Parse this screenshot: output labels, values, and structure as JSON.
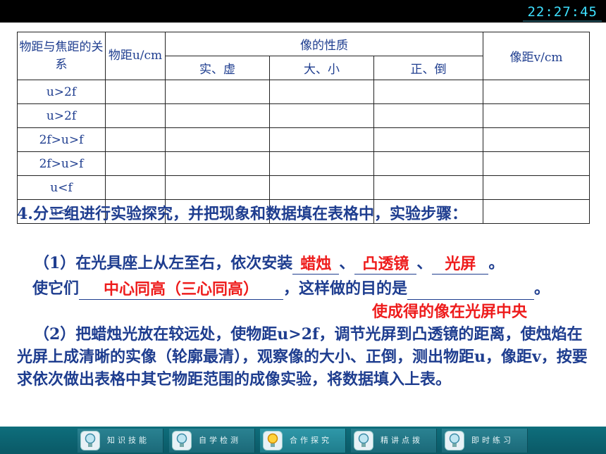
{
  "clock": "22:27:45",
  "table": {
    "headers": {
      "relation": "物距与焦距的关系",
      "object_distance": "物距u/cm",
      "image_nature": "像的性质",
      "real_virtual": "实、虚",
      "size": "大、小",
      "upright_inverted": "正、倒",
      "image_distance": "像距v/cm"
    },
    "rows": [
      "u>2f",
      "u>2f",
      "2f>u>f",
      "2f>u>f",
      "u<f",
      "u<f"
    ]
  },
  "content": {
    "step4_heading": "4.分三组进行实验探究，并把现象和数据填在表格中，实验步骤：",
    "s1_prefix": "（1）在光具座上从左至右，依次安装",
    "s1_sep1": "、",
    "s1_sep2": "、",
    "s1_end": "。",
    "s1_line2_prefix": "使它们",
    "s1_line2_mid": "，这样做的目的是",
    "s1_line2_end": "。",
    "s2": "（2）把蜡烛光放在较远处，使物距u>2f，调节光屏到凸透镜的距离，使烛焰在光屏上成清晰的实像（轮廓最清），观察像的大小、正倒，测出物距u，像距v，按要求依次做出表格中其它物距范围的成像实验，将数据填入上表。"
  },
  "answers": {
    "item1": "蜡烛",
    "item2": "凸透镜",
    "item3": "光屏",
    "centers": "中心同高（三心同高）",
    "purpose": "使成得的像在光屏中央"
  },
  "nav": {
    "items": [
      "知识技能",
      "自学检测",
      "合作探究",
      "精讲点拨",
      "即时练习"
    ],
    "active_index": 2
  },
  "colors": {
    "text": "#1e3d8f",
    "answer": "#ee1c1c",
    "nav_bg": "#0b5f6c",
    "clock": "#3ee0ff"
  }
}
